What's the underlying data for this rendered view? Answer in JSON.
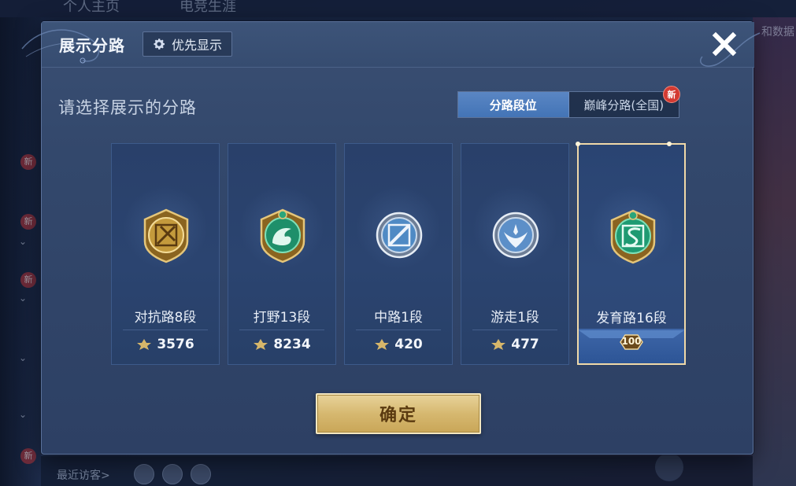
{
  "background": {
    "top_tabs": [
      "个人主页",
      "电竞生涯"
    ],
    "right_text": "和数据",
    "new_badge": "新",
    "recent_visitors": "最近访客>"
  },
  "dialog": {
    "title": "展示分路",
    "priority_button": {
      "label": "优先显示",
      "icon": "gear-icon"
    },
    "close_icon": "close-icon",
    "subtitle": "请选择展示的分路",
    "tabs": [
      {
        "label": "分路段位",
        "active": true
      },
      {
        "label": "巅峰分路(全国)",
        "active": false,
        "badge": "新"
      }
    ],
    "cards": [
      {
        "lane": "对抗路8段",
        "score": "3576",
        "badge_color": "gold",
        "selected": false
      },
      {
        "lane": "打野13段",
        "score": "8234",
        "badge_color": "green",
        "selected": false
      },
      {
        "lane": "中路1段",
        "score": "420",
        "badge_color": "silver",
        "selected": false
      },
      {
        "lane": "游走1段",
        "score": "477",
        "badge_color": "silver",
        "selected": false
      },
      {
        "lane": "发育路16段",
        "score": "",
        "rank_badge": "100",
        "badge_color": "green",
        "selected": true
      }
    ],
    "confirm_label": "确定"
  },
  "colors": {
    "accent_tab": "#4374b6",
    "confirm_gold": "#d6b870",
    "selected_border": "#f0d9a8"
  }
}
